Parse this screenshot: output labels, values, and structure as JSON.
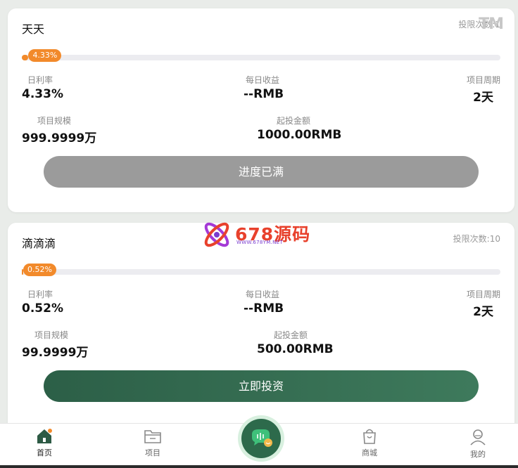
{
  "products": [
    {
      "name": "天天",
      "limit_text": "投限次数:1",
      "progress_label": "4.33%",
      "progress": 0.0433,
      "fields": {
        "daily_rate_label": "日利率",
        "daily_rate": "4.33%",
        "daily_income_label": "每日收益",
        "daily_income": "--RMB",
        "period_label": "项目周期",
        "period": "2天",
        "scale_label": "项目规模",
        "scale": "999.9999万",
        "min_invest_label": "起投金额",
        "min_invest": "1000.00RMB"
      },
      "button_label": "进度已满"
    },
    {
      "name": "滴滴滴",
      "limit_text": "投限次数:10",
      "progress_label": "0.52%",
      "progress": 0.0052,
      "fields": {
        "daily_rate_label": "日利率",
        "daily_rate": "0.52%",
        "daily_income_label": "每日收益",
        "daily_income": "--RMB",
        "period_label": "项目周期",
        "period": "2天",
        "scale_label": "项目规模",
        "scale": "99.9999万",
        "min_invest_label": "起投金额",
        "min_invest": "500.00RMB"
      },
      "button_label": "立即投资"
    }
  ],
  "watermark": {
    "brand": "678源码",
    "url": "WWW.678YM.NET",
    "tm": "TM"
  },
  "nav": {
    "home": "首页",
    "projects": "项目",
    "mall": "商城",
    "mine": "我的"
  },
  "colors": {
    "accent": "#f28a2b",
    "primary": "#2d6a4b",
    "disabled": "#9b9b9b"
  }
}
